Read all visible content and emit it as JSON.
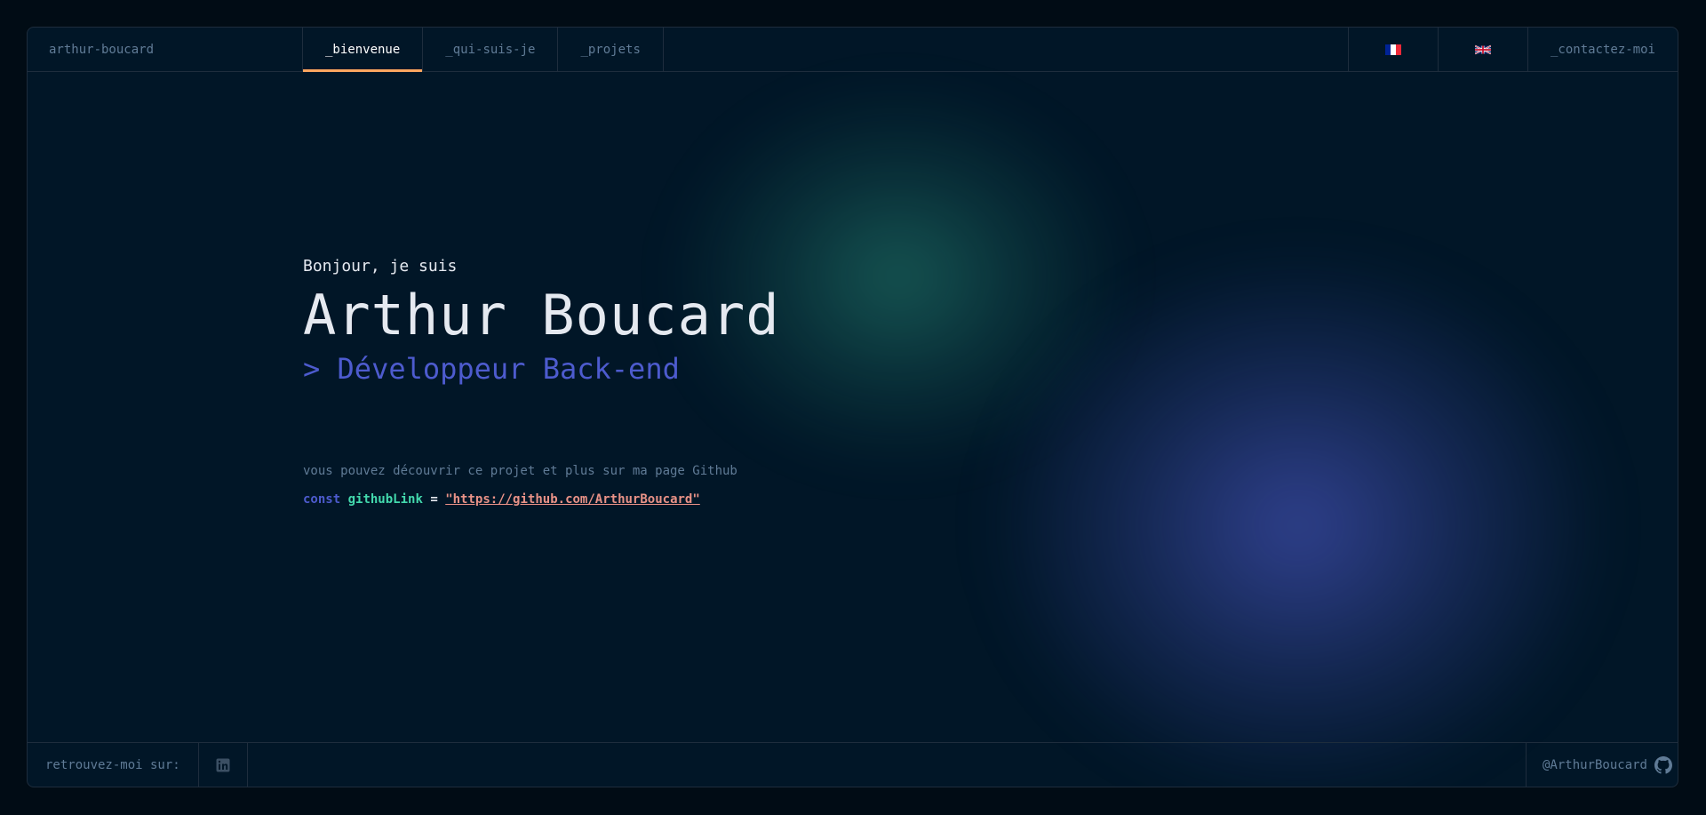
{
  "header": {
    "brand": "arthur-boucard",
    "tabs": [
      {
        "label": "_bienvenue"
      },
      {
        "label": "_qui-suis-je"
      },
      {
        "label": "_projets"
      }
    ],
    "languages": [
      {
        "icon": "flag-fr-icon"
      },
      {
        "icon": "flag-uk-icon"
      }
    ],
    "contact": "_contactez-moi"
  },
  "hero": {
    "greeting": "Bonjour, je suis",
    "name": "Arthur Boucard",
    "role": "> Développeur Back-end",
    "comment": "vous pouvez découvrir ce projet et plus sur ma page Github",
    "code": {
      "keyword": "const",
      "variable": "githubLink",
      "operator": "=",
      "value": "\"https://github.com/ArthurBoucard\""
    }
  },
  "footer": {
    "label": "retrouvez-moi sur:",
    "social_icon": "linkedin-icon",
    "handle": "@ArthurBoucard",
    "handle_icon": "github-icon"
  },
  "colors": {
    "background": "#011627",
    "border": "#1e2d3d",
    "muted_text": "#607b96",
    "accent_orange": "#fea55f",
    "accent_blue": "#4d5bce",
    "accent_green": "#43d9ad",
    "string_salmon": "#e99287"
  }
}
